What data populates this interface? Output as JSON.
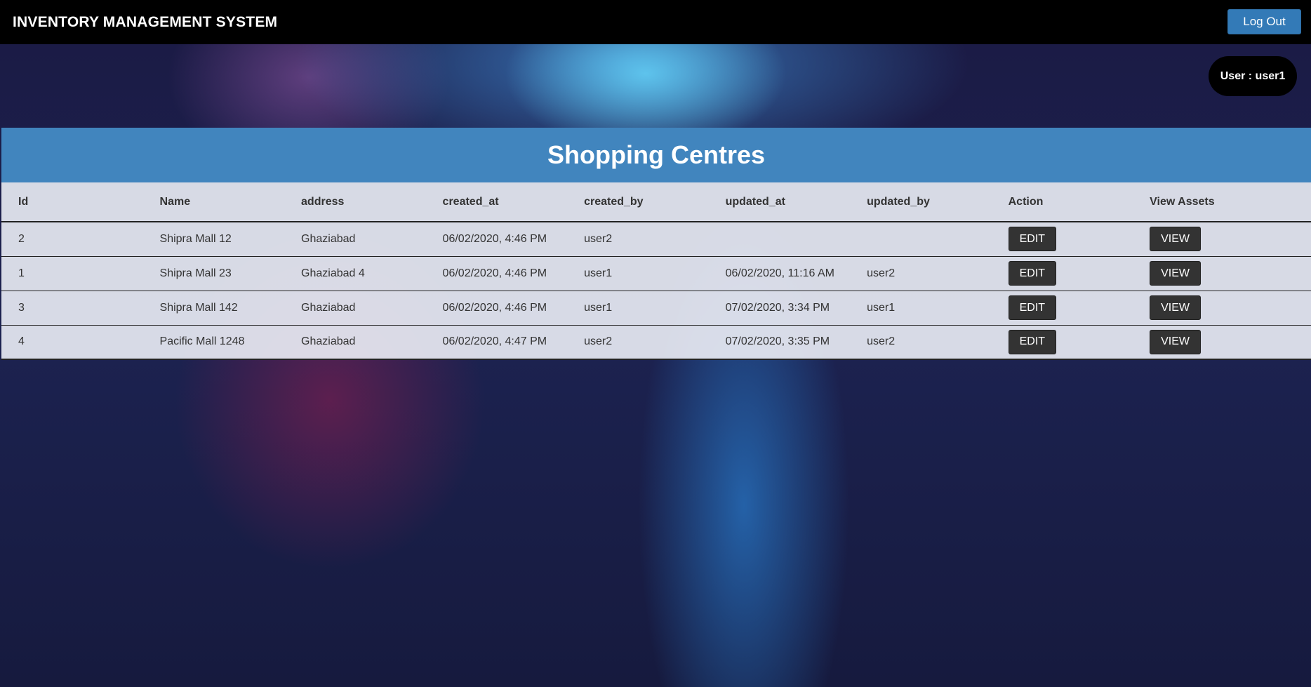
{
  "header": {
    "title": "INVENTORY MANAGEMENT SYSTEM",
    "logout_label": "Log Out"
  },
  "user_badge": "User : user1",
  "panel": {
    "title": "Shopping Centres"
  },
  "table": {
    "columns": [
      "Id",
      "Name",
      "address",
      "created_at",
      "created_by",
      "updated_at",
      "updated_by",
      "Action",
      "View Assets"
    ],
    "rows": [
      {
        "id": "2",
        "name": "Shipra Mall 12",
        "address": "Ghaziabad",
        "created_at": "06/02/2020, 4:46 PM",
        "created_by": "user2",
        "updated_at": "",
        "updated_by": "",
        "action_label": "EDIT",
        "view_label": "VIEW"
      },
      {
        "id": "1",
        "name": "Shipra Mall 23",
        "address": "Ghaziabad 4",
        "created_at": "06/02/2020, 4:46 PM",
        "created_by": "user1",
        "updated_at": "06/02/2020, 11:16 AM",
        "updated_by": "user2",
        "action_label": "EDIT",
        "view_label": "VIEW"
      },
      {
        "id": "3",
        "name": "Shipra Mall 142",
        "address": "Ghaziabad",
        "created_at": "06/02/2020, 4:46 PM",
        "created_by": "user1",
        "updated_at": "07/02/2020, 3:34 PM",
        "updated_by": "user1",
        "action_label": "EDIT",
        "view_label": "VIEW"
      },
      {
        "id": "4",
        "name": "Pacific Mall 1248",
        "address": "Ghaziabad",
        "created_at": "06/02/2020, 4:47 PM",
        "created_by": "user2",
        "updated_at": "07/02/2020, 3:35 PM",
        "updated_by": "user2",
        "action_label": "EDIT",
        "view_label": "VIEW"
      }
    ]
  },
  "colors": {
    "topbar": "#000000",
    "logout_button": "#337ab7",
    "panel_header": "#4185be",
    "action_button": "#333333"
  }
}
